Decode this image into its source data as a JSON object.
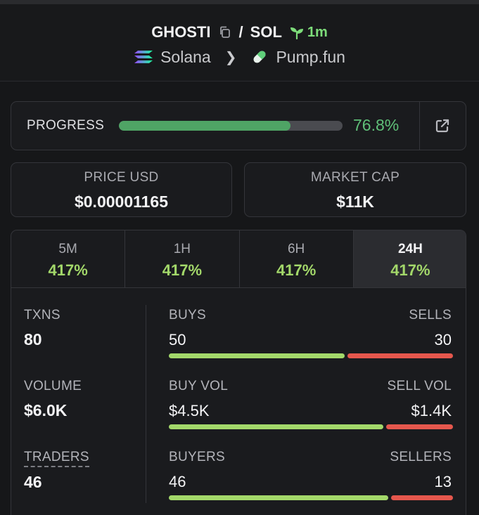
{
  "header": {
    "token": "GHOSTI",
    "separator": "/",
    "quote": "SOL",
    "age": "1m",
    "chain": "Solana",
    "platform": "Pump.fun"
  },
  "progress": {
    "label": "PROGRESS",
    "value_text": "76.8%",
    "percent": 76.8
  },
  "price": {
    "label": "PRICE USD",
    "value": "$0.00001165"
  },
  "market_cap": {
    "label": "MARKET CAP",
    "value": "$11K"
  },
  "tabs": [
    {
      "label": "5M",
      "value": "417%"
    },
    {
      "label": "1H",
      "value": "417%"
    },
    {
      "label": "6H",
      "value": "417%"
    },
    {
      "label": "24H",
      "value": "417%",
      "active": true
    }
  ],
  "stats": {
    "txns": {
      "label": "TXNS",
      "value": "80"
    },
    "volume": {
      "label": "VOLUME",
      "value": "$6.0K"
    },
    "traders": {
      "label": "TRADERS",
      "value": "46"
    }
  },
  "splits": {
    "buys_sells": {
      "left_label": "BUYS",
      "right_label": "SELLS",
      "left_value": "50",
      "right_value": "30",
      "buy_fraction": 0.625
    },
    "volume": {
      "left_label": "BUY VOL",
      "right_label": "SELL VOL",
      "left_value": "$4.5K",
      "right_value": "$1.4K",
      "buy_fraction": 0.763
    },
    "buyers_sellers": {
      "left_label": "BUYERS",
      "right_label": "SELLERS",
      "left_value": "46",
      "right_value": "13",
      "buy_fraction": 0.78
    }
  },
  "colors": {
    "accent_green": "#5fbf78",
    "buy_green": "#a3d86a",
    "sell_red": "#e5574d"
  }
}
